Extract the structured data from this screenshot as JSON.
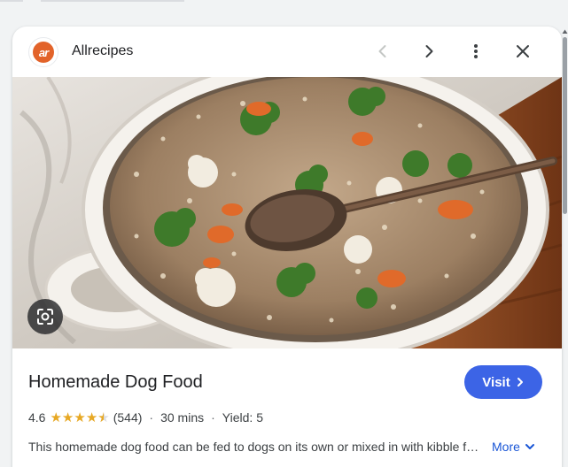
{
  "header": {
    "site_name": "Allrecipes",
    "logo_text": "ar",
    "prev_icon": "chevron-left-icon",
    "next_icon": "chevron-right-icon",
    "more_icon": "more-vert-icon",
    "close_icon": "close-icon"
  },
  "image": {
    "subject": "dog-food-pot",
    "lens_icon": "lens-search-icon"
  },
  "recipe": {
    "title": "Homemade Dog Food",
    "visit_label": "Visit",
    "rating": "4.6",
    "rating_value": 4.6,
    "review_count": "(544)",
    "time": "30 mins",
    "yield": "Yield: 5",
    "description": "This homemade dog food can be fed to dogs on its own or mixed in with kibble for a healthy, tasty meal.",
    "more_label": "More"
  },
  "colors": {
    "accent": "#3c64e6",
    "star": "#e7a824",
    "link": "#1a56d6",
    "brand": "#e2632a"
  }
}
